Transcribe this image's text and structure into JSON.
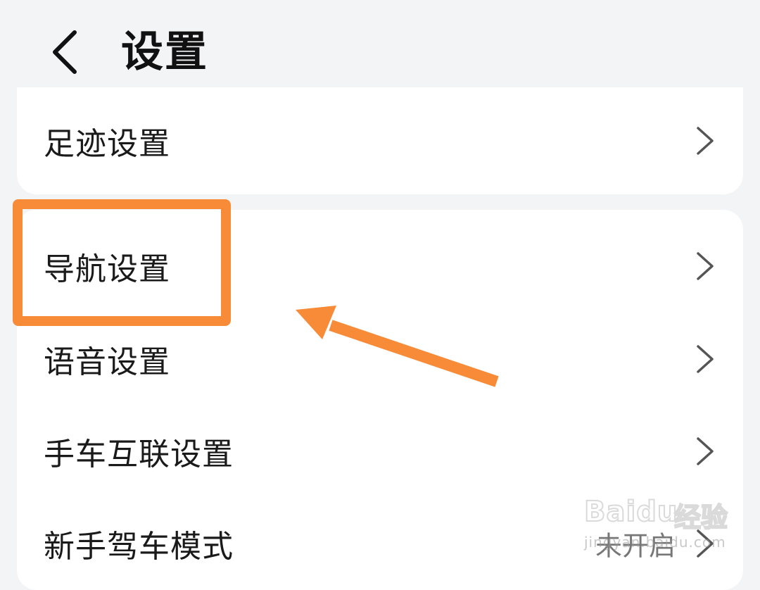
{
  "header": {
    "back_icon": "chevron-left-icon",
    "title": "设置"
  },
  "group1": {
    "items": [
      {
        "label": "足迹设置",
        "icon": "chevron-right-icon"
      }
    ]
  },
  "group2": {
    "items": [
      {
        "label": "导航设置",
        "icon": "chevron-right-icon",
        "highlighted": true
      },
      {
        "label": "语音设置",
        "icon": "chevron-right-icon"
      },
      {
        "label": "手车互联设置",
        "icon": "chevron-right-icon"
      },
      {
        "label": "新手驾车模式",
        "value": "未开启",
        "icon": "chevron-right-icon"
      }
    ]
  },
  "annotation": {
    "color": "#f78b37"
  },
  "watermark": {
    "brand": "Baidu",
    "brand_cn": "经验",
    "url": "jingyan.baidu.com"
  }
}
